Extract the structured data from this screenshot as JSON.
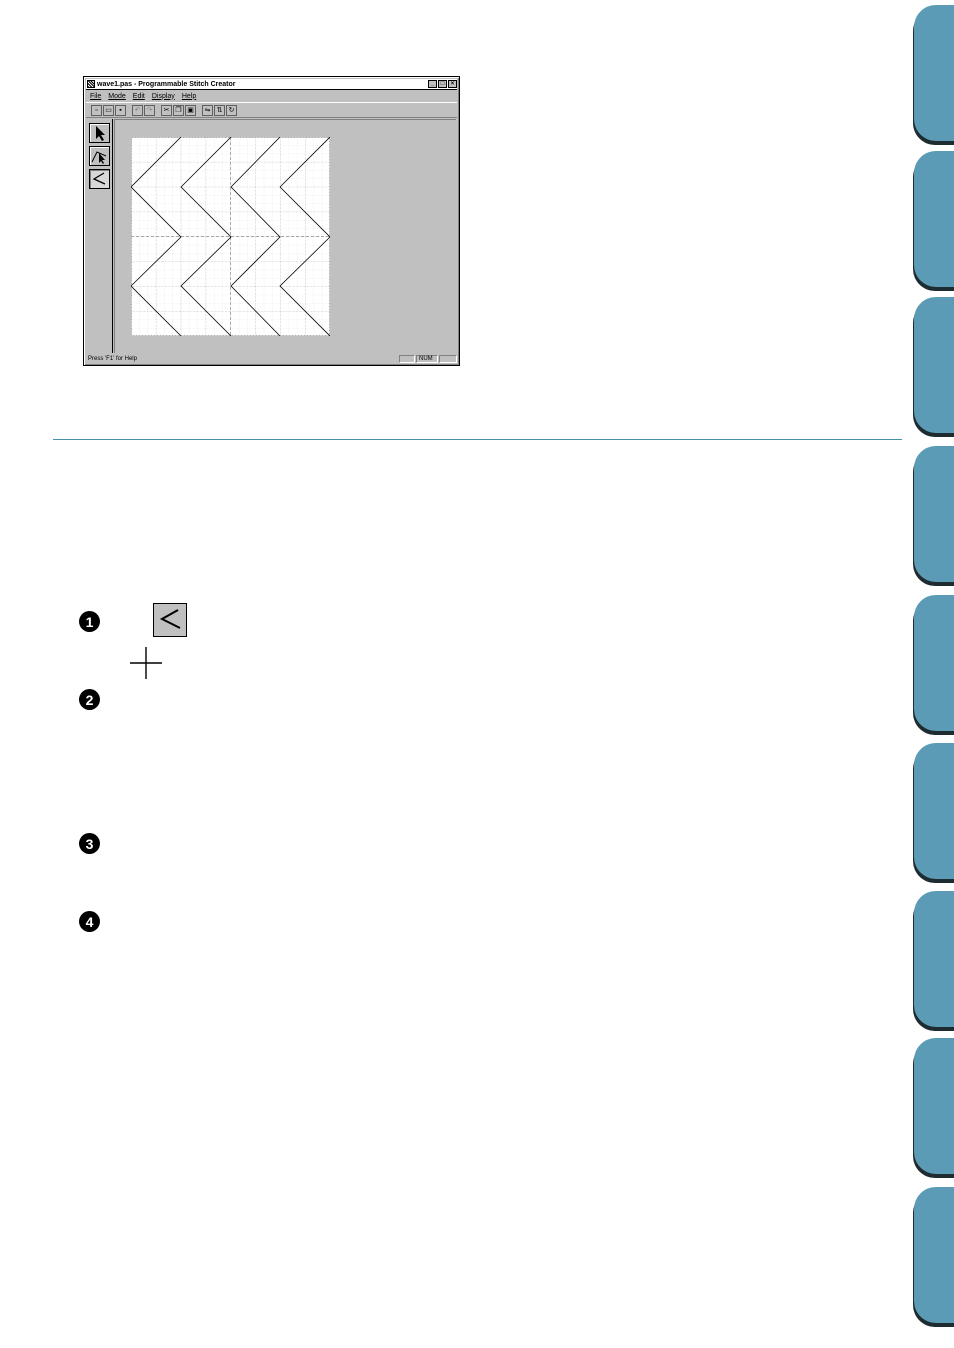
{
  "window": {
    "title": "wave1.pas - Programmable Stitch Creator",
    "controls": {
      "minimize": "_",
      "maximize": "□",
      "close": "×"
    },
    "menu": [
      "File",
      "Mode",
      "Edit",
      "Display",
      "Help"
    ],
    "status": {
      "help_text": "Press 'F1' for Help",
      "num": "NUM"
    }
  },
  "steps": [
    "1",
    "2",
    "3",
    "4"
  ],
  "side_tabs_count": 9,
  "colors": {
    "accent": "#5b9bb5",
    "rule": "#4a8fa8"
  }
}
